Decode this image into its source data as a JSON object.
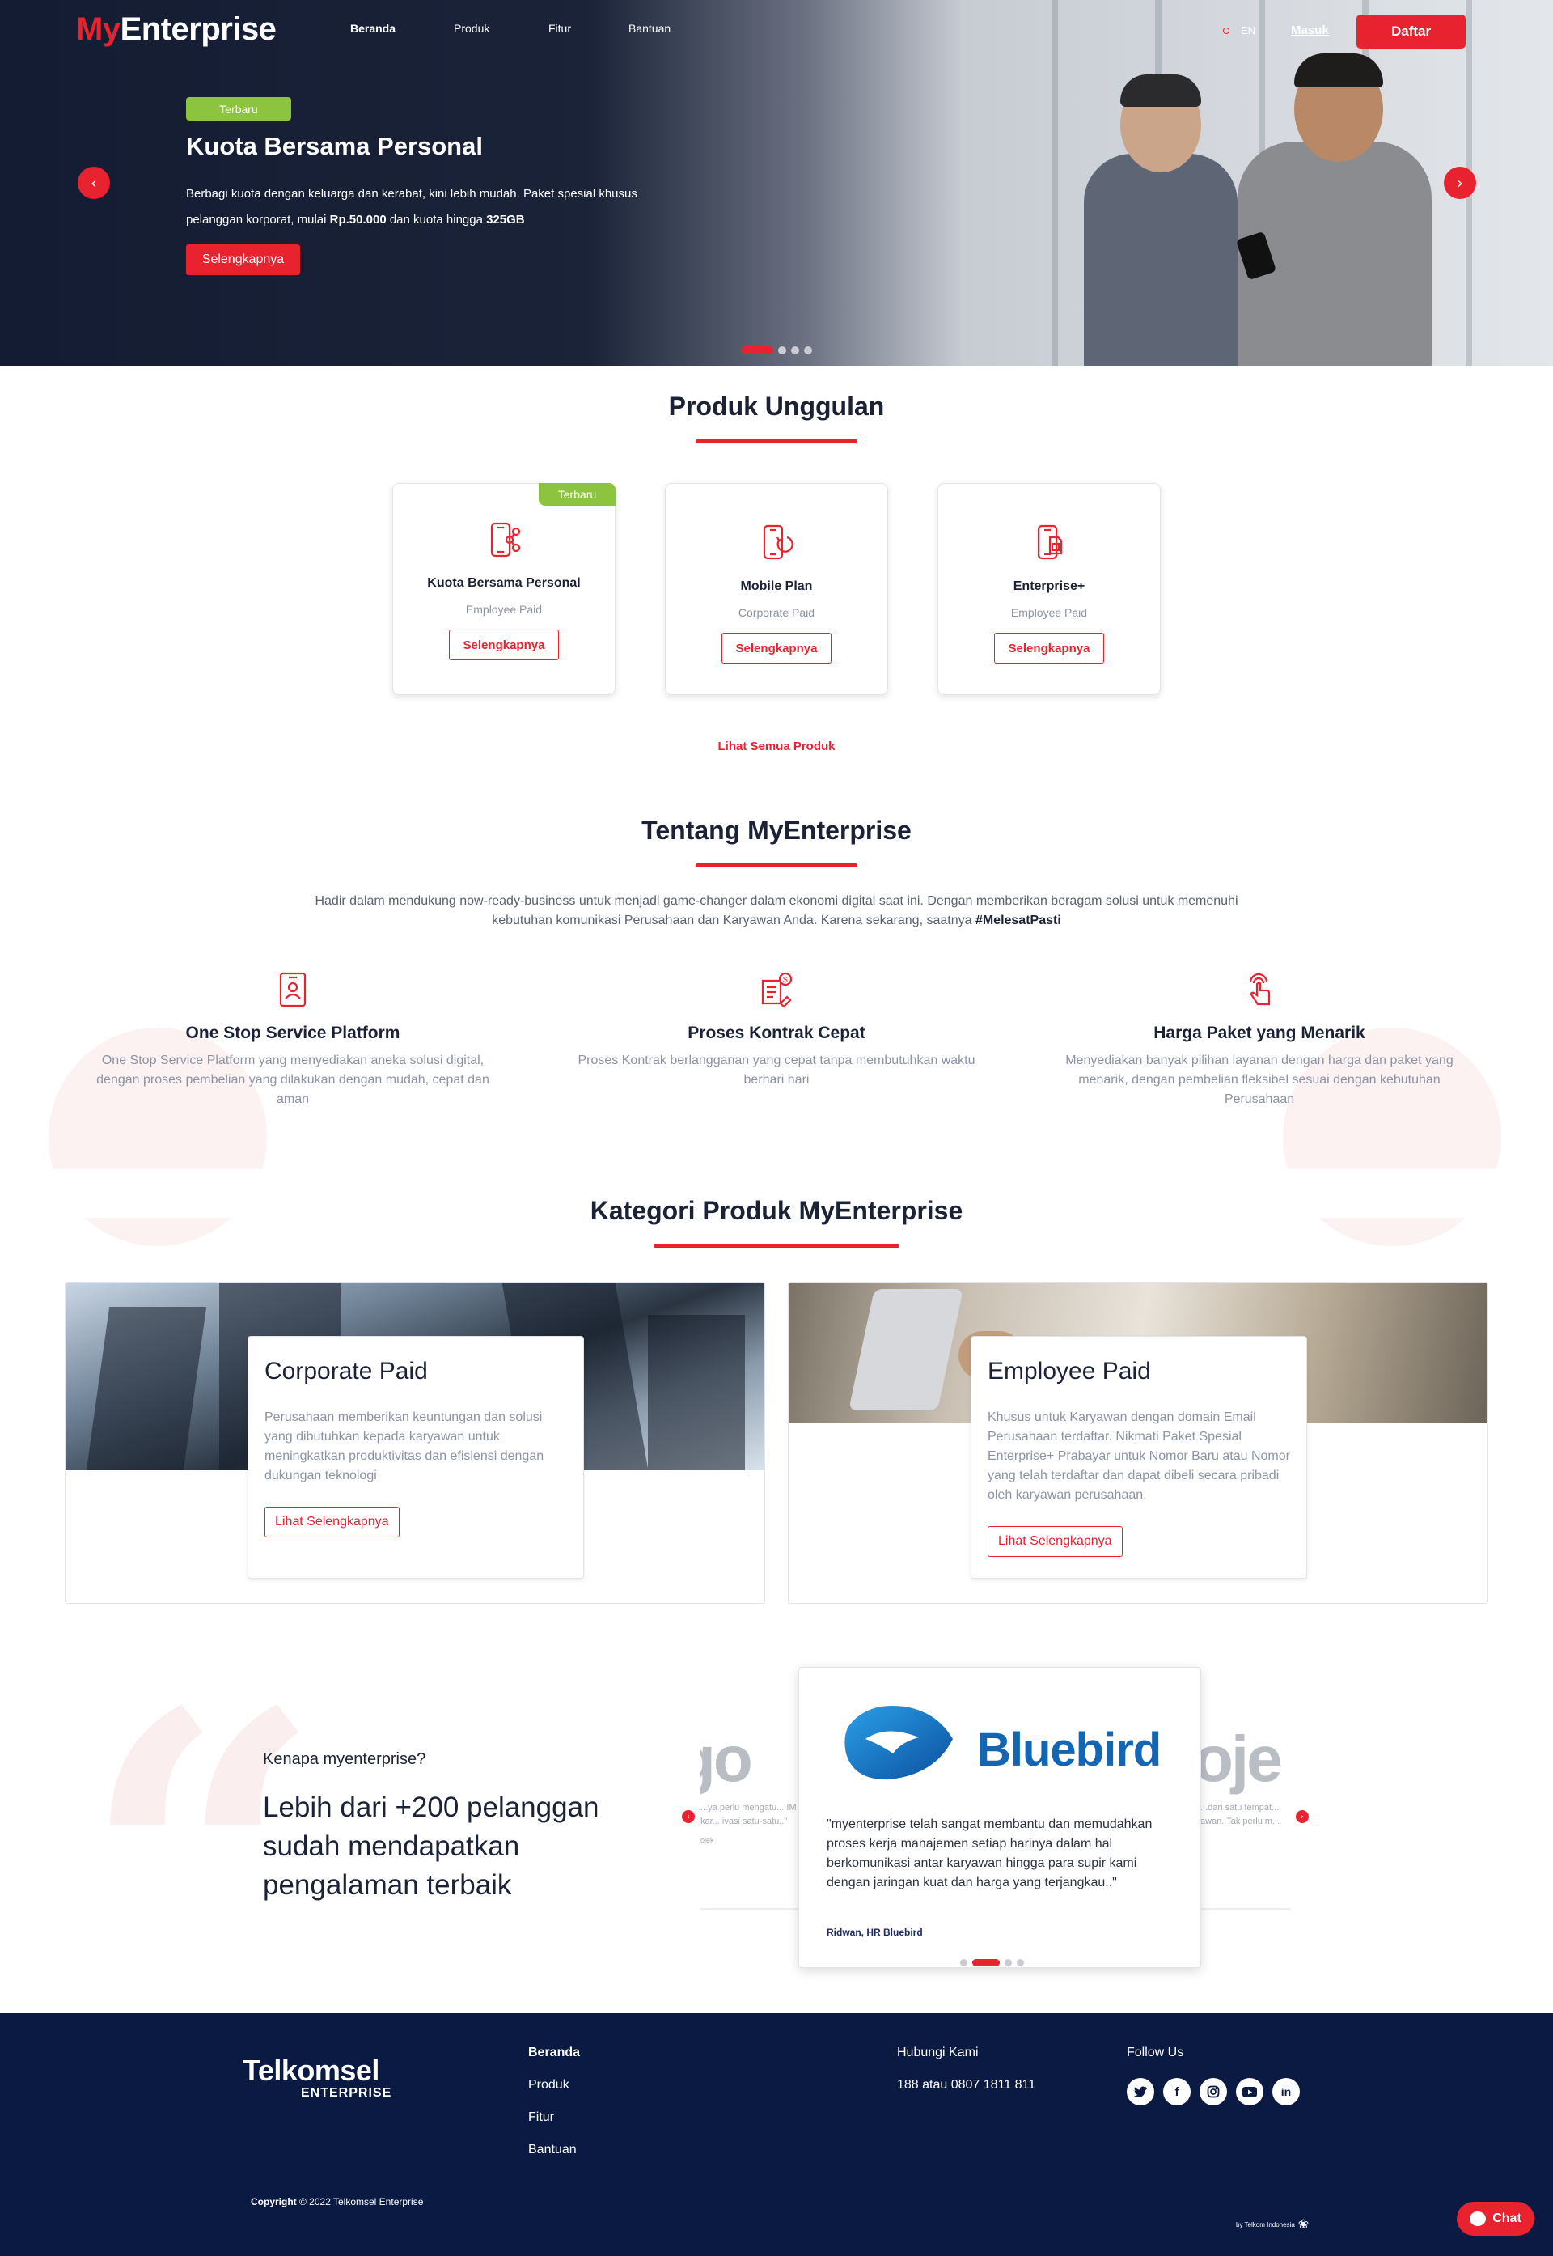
{
  "brand": {
    "logo_my": "My",
    "logo_enterprise": "Enterprise"
  },
  "nav": {
    "items": [
      "Beranda",
      "Produk",
      "Fitur",
      "Bantuan"
    ],
    "active": "Beranda",
    "lang": "EN",
    "login": "Masuk",
    "register": "Daftar"
  },
  "hero": {
    "badge": "Terbaru",
    "title": "Kuota Bersama Personal",
    "desc_part1": "Berbagi kuota dengan keluarga dan kerabat, kini lebih mudah. Paket spesial khusus pelanggan korporat, mulai ",
    "desc_price": "Rp.50.000",
    "desc_part2": " dan kuota hingga ",
    "desc_quota": "325GB",
    "cta": "Selengkapnya",
    "slide_count": 4,
    "active_slide": 1
  },
  "featured": {
    "title": "Produk Unggulan",
    "products": [
      {
        "name": "Kuota Bersama Personal",
        "type": "Employee Paid",
        "button": "Selengkapnya",
        "ribbon": "Terbaru",
        "icon": "phone-share-icon"
      },
      {
        "name": "Mobile Plan",
        "type": "Corporate Paid",
        "button": "Selengkapnya",
        "ribbon": "",
        "icon": "phone-refresh-icon"
      },
      {
        "name": "Enterprise+",
        "type": "Employee Paid",
        "button": "Selengkapnya",
        "ribbon": "",
        "icon": "phone-sim-icon"
      }
    ],
    "see_all": "Lihat Semua Produk"
  },
  "about": {
    "title": "Tentang MyEnterprise",
    "desc": "Hadir dalam mendukung now-ready-business untuk menjadi game-changer dalam ekonomi digital saat ini. Dengan memberikan beragam solusi untuk memenuhi kebutuhan komunikasi Perusahaan dan Karyawan Anda. Karena sekarang, saatnya ",
    "hashtag": "#MelesatPasti",
    "features": [
      {
        "title": "One Stop Service Platform",
        "desc": "One Stop Service Platform yang menyediakan aneka solusi digital, dengan proses pembelian yang dilakukan dengan mudah, cepat dan aman",
        "icon": "id-badge-icon"
      },
      {
        "title": "Proses Kontrak Cepat",
        "desc": "Proses Kontrak berlangganan yang cepat tanpa membutuhkan waktu berhari hari",
        "icon": "contract-money-icon"
      },
      {
        "title": "Harga Paket yang Menarik",
        "desc": "Menyediakan banyak pilihan layanan dengan harga dan paket yang menarik, dengan pembelian fleksibel sesuai dengan kebutuhan Perusahaan",
        "icon": "hand-touch-icon"
      }
    ]
  },
  "categories": {
    "title": "Kategori Produk MyEnterprise",
    "items": [
      {
        "title": "Corporate Paid",
        "desc": "Perusahaan memberikan keuntungan dan solusi yang dibutuhkan kepada karyawan untuk meningkatkan produktivitas dan efisiensi dengan dukungan teknologi",
        "button": "Lihat Selengkapnya"
      },
      {
        "title": "Employee Paid",
        "desc": "Khusus untuk Karyawan dengan domain Email Perusahaan terdaftar. Nikmati Paket Spesial Enterprise+ Prabayar untuk Nomor Baru atau Nomor yang telah terdaftar dan dapat dibeli secara pribadi oleh karyawan perusahaan.",
        "button": "Lihat Selengkapnya"
      }
    ]
  },
  "testimonial": {
    "kicker": "Kenapa myenterprise?",
    "headline": "Lebih dari +200 pelanggan sudah mendapatkan pengalaman terbaik",
    "left_logo": "go",
    "left_text": "...ya perlu mengatu... IM Card semua kar... ivasi satu-satu..\"",
    "left_author": "ojek",
    "right_logo": "oje",
    "right_text": "...dari satu tempat... awan. Tak perlu m...",
    "active": {
      "company": "Bluebird",
      "quote": "\"myenterprise telah sangat membantu dan memudahkan proses kerja manajemen setiap harinya dalam hal berkomunikasi antar karyawan hingga para supir kami dengan jaringan kuat dan harga yang terjangkau..\"",
      "author": "Ridwan, HR Bluebird"
    },
    "slide_count": 4,
    "active_slide": 2
  },
  "footer": {
    "logo_main": "Telkomsel",
    "logo_sub": "ENTERPRISE",
    "links": [
      "Beranda",
      "Produk",
      "Fitur",
      "Bantuan"
    ],
    "contact_title": "Hubungi Kami",
    "contact_value": "188 atau 0807 1811 811",
    "follow_title": "Follow Us",
    "socials": [
      "twitter-icon",
      "facebook-icon",
      "instagram-icon",
      "youtube-icon",
      "linkedin-icon"
    ],
    "copyright_bold": "Copyright",
    "copyright_rest": " © 2022 Telkomsel Enterprise",
    "by_telkom": "by Telkom Indonesia"
  },
  "chat": {
    "label": "Chat"
  },
  "colors": {
    "accent": "#e8222e",
    "navy": "#0a1a43",
    "green": "#8cc43f",
    "heading": "#1c2236",
    "muted": "#8c93a4"
  }
}
